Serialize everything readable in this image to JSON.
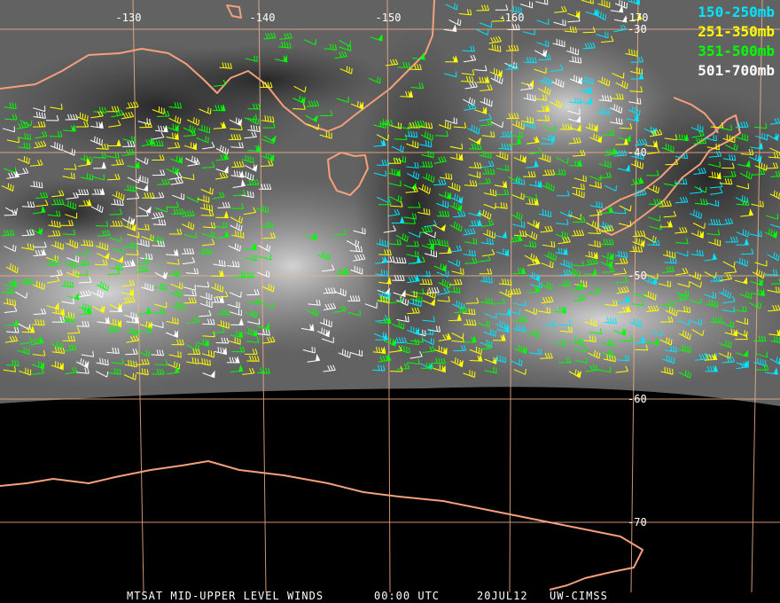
{
  "longitude_labels": [
    "-130",
    "-140",
    "-150",
    "-160",
    "-170"
  ],
  "latitude_labels": [
    "-30",
    "-40",
    "-50",
    "-60",
    "-70"
  ],
  "legend": [
    {
      "label": "150-250mb",
      "color": "#00e5ff"
    },
    {
      "label": "251-350mb",
      "color": "#ffff00"
    },
    {
      "label": "351-500mb",
      "color": "#00ff00"
    },
    {
      "label": "501-700mb",
      "color": "#ffffff"
    }
  ],
  "footer": {
    "satellite": "MTSAT MID-UPPER LEVEL WINDS",
    "time": "00:00 UTC",
    "date": "20JUL12",
    "source": "UW-CIMSS"
  },
  "colors": {
    "coastline": "#f4a07a",
    "gridline": "#f0b088",
    "space": "#000000"
  }
}
